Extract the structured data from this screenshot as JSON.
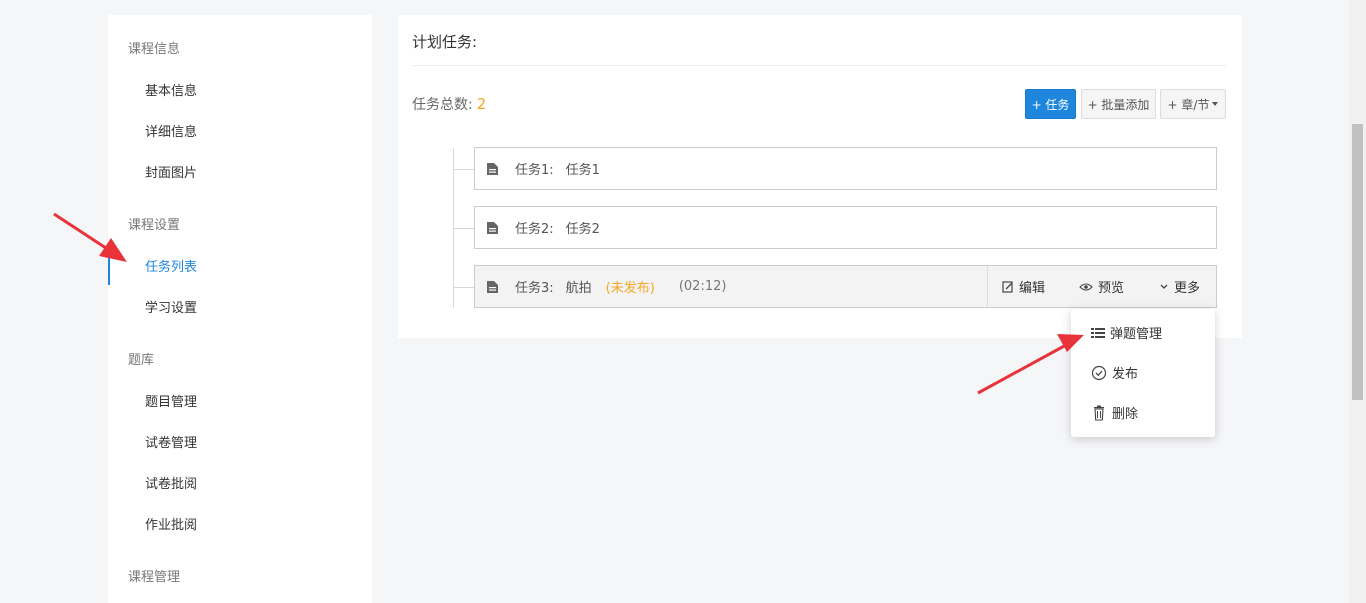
{
  "sidebar": {
    "groups": [
      {
        "label": "课程信息",
        "items": [
          "基本信息",
          "详细信息",
          "封面图片"
        ]
      },
      {
        "label": "课程设置",
        "items": [
          "任务列表",
          "学习设置"
        ]
      },
      {
        "label": "题库",
        "items": [
          "题目管理",
          "试卷管理",
          "试卷批阅",
          "作业批阅"
        ]
      },
      {
        "label": "课程管理",
        "items": []
      }
    ],
    "active_item": "任务列表"
  },
  "panel": {
    "title": "计划任务:",
    "count_label": "任务总数:",
    "count_value": "2",
    "buttons": {
      "add_task": "+ 任务",
      "batch_add": "+ 批量添加",
      "chapter": "+ 章/节"
    }
  },
  "tasks": [
    {
      "index": "任务1:",
      "name": "任务1"
    },
    {
      "index": "任务2:",
      "name": "任务2"
    },
    {
      "index": "任务3:",
      "name": "航拍",
      "status": "(未发布)",
      "duration": "(02:12)"
    }
  ],
  "row_actions": {
    "edit": "编辑",
    "preview": "预览",
    "more": "更多"
  },
  "dropdown": {
    "items": [
      "弹题管理",
      "发布",
      "删除"
    ]
  },
  "colors": {
    "accent": "#1f86dd",
    "warning": "#f5a623",
    "annotation_arrow": "#e8333a"
  }
}
